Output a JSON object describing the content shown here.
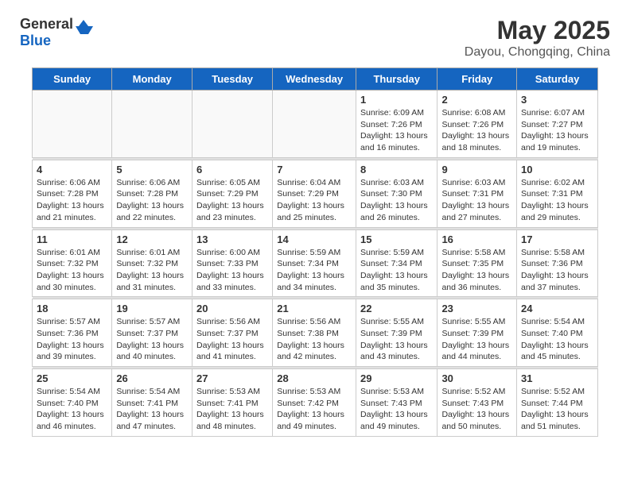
{
  "header": {
    "logo_general": "General",
    "logo_blue": "Blue",
    "month_year": "May 2025",
    "location": "Dayou, Chongqing, China"
  },
  "days_of_week": [
    "Sunday",
    "Monday",
    "Tuesday",
    "Wednesday",
    "Thursday",
    "Friday",
    "Saturday"
  ],
  "weeks": [
    [
      {
        "day": "",
        "info": ""
      },
      {
        "day": "",
        "info": ""
      },
      {
        "day": "",
        "info": ""
      },
      {
        "day": "",
        "info": ""
      },
      {
        "day": "1",
        "info": "Sunrise: 6:09 AM\nSunset: 7:26 PM\nDaylight: 13 hours\nand 16 minutes."
      },
      {
        "day": "2",
        "info": "Sunrise: 6:08 AM\nSunset: 7:26 PM\nDaylight: 13 hours\nand 18 minutes."
      },
      {
        "day": "3",
        "info": "Sunrise: 6:07 AM\nSunset: 7:27 PM\nDaylight: 13 hours\nand 19 minutes."
      }
    ],
    [
      {
        "day": "4",
        "info": "Sunrise: 6:06 AM\nSunset: 7:28 PM\nDaylight: 13 hours\nand 21 minutes."
      },
      {
        "day": "5",
        "info": "Sunrise: 6:06 AM\nSunset: 7:28 PM\nDaylight: 13 hours\nand 22 minutes."
      },
      {
        "day": "6",
        "info": "Sunrise: 6:05 AM\nSunset: 7:29 PM\nDaylight: 13 hours\nand 23 minutes."
      },
      {
        "day": "7",
        "info": "Sunrise: 6:04 AM\nSunset: 7:29 PM\nDaylight: 13 hours\nand 25 minutes."
      },
      {
        "day": "8",
        "info": "Sunrise: 6:03 AM\nSunset: 7:30 PM\nDaylight: 13 hours\nand 26 minutes."
      },
      {
        "day": "9",
        "info": "Sunrise: 6:03 AM\nSunset: 7:31 PM\nDaylight: 13 hours\nand 27 minutes."
      },
      {
        "day": "10",
        "info": "Sunrise: 6:02 AM\nSunset: 7:31 PM\nDaylight: 13 hours\nand 29 minutes."
      }
    ],
    [
      {
        "day": "11",
        "info": "Sunrise: 6:01 AM\nSunset: 7:32 PM\nDaylight: 13 hours\nand 30 minutes."
      },
      {
        "day": "12",
        "info": "Sunrise: 6:01 AM\nSunset: 7:32 PM\nDaylight: 13 hours\nand 31 minutes."
      },
      {
        "day": "13",
        "info": "Sunrise: 6:00 AM\nSunset: 7:33 PM\nDaylight: 13 hours\nand 33 minutes."
      },
      {
        "day": "14",
        "info": "Sunrise: 5:59 AM\nSunset: 7:34 PM\nDaylight: 13 hours\nand 34 minutes."
      },
      {
        "day": "15",
        "info": "Sunrise: 5:59 AM\nSunset: 7:34 PM\nDaylight: 13 hours\nand 35 minutes."
      },
      {
        "day": "16",
        "info": "Sunrise: 5:58 AM\nSunset: 7:35 PM\nDaylight: 13 hours\nand 36 minutes."
      },
      {
        "day": "17",
        "info": "Sunrise: 5:58 AM\nSunset: 7:36 PM\nDaylight: 13 hours\nand 37 minutes."
      }
    ],
    [
      {
        "day": "18",
        "info": "Sunrise: 5:57 AM\nSunset: 7:36 PM\nDaylight: 13 hours\nand 39 minutes."
      },
      {
        "day": "19",
        "info": "Sunrise: 5:57 AM\nSunset: 7:37 PM\nDaylight: 13 hours\nand 40 minutes."
      },
      {
        "day": "20",
        "info": "Sunrise: 5:56 AM\nSunset: 7:37 PM\nDaylight: 13 hours\nand 41 minutes."
      },
      {
        "day": "21",
        "info": "Sunrise: 5:56 AM\nSunset: 7:38 PM\nDaylight: 13 hours\nand 42 minutes."
      },
      {
        "day": "22",
        "info": "Sunrise: 5:55 AM\nSunset: 7:39 PM\nDaylight: 13 hours\nand 43 minutes."
      },
      {
        "day": "23",
        "info": "Sunrise: 5:55 AM\nSunset: 7:39 PM\nDaylight: 13 hours\nand 44 minutes."
      },
      {
        "day": "24",
        "info": "Sunrise: 5:54 AM\nSunset: 7:40 PM\nDaylight: 13 hours\nand 45 minutes."
      }
    ],
    [
      {
        "day": "25",
        "info": "Sunrise: 5:54 AM\nSunset: 7:40 PM\nDaylight: 13 hours\nand 46 minutes."
      },
      {
        "day": "26",
        "info": "Sunrise: 5:54 AM\nSunset: 7:41 PM\nDaylight: 13 hours\nand 47 minutes."
      },
      {
        "day": "27",
        "info": "Sunrise: 5:53 AM\nSunset: 7:41 PM\nDaylight: 13 hours\nand 48 minutes."
      },
      {
        "day": "28",
        "info": "Sunrise: 5:53 AM\nSunset: 7:42 PM\nDaylight: 13 hours\nand 49 minutes."
      },
      {
        "day": "29",
        "info": "Sunrise: 5:53 AM\nSunset: 7:43 PM\nDaylight: 13 hours\nand 49 minutes."
      },
      {
        "day": "30",
        "info": "Sunrise: 5:52 AM\nSunset: 7:43 PM\nDaylight: 13 hours\nand 50 minutes."
      },
      {
        "day": "31",
        "info": "Sunrise: 5:52 AM\nSunset: 7:44 PM\nDaylight: 13 hours\nand 51 minutes."
      }
    ]
  ]
}
